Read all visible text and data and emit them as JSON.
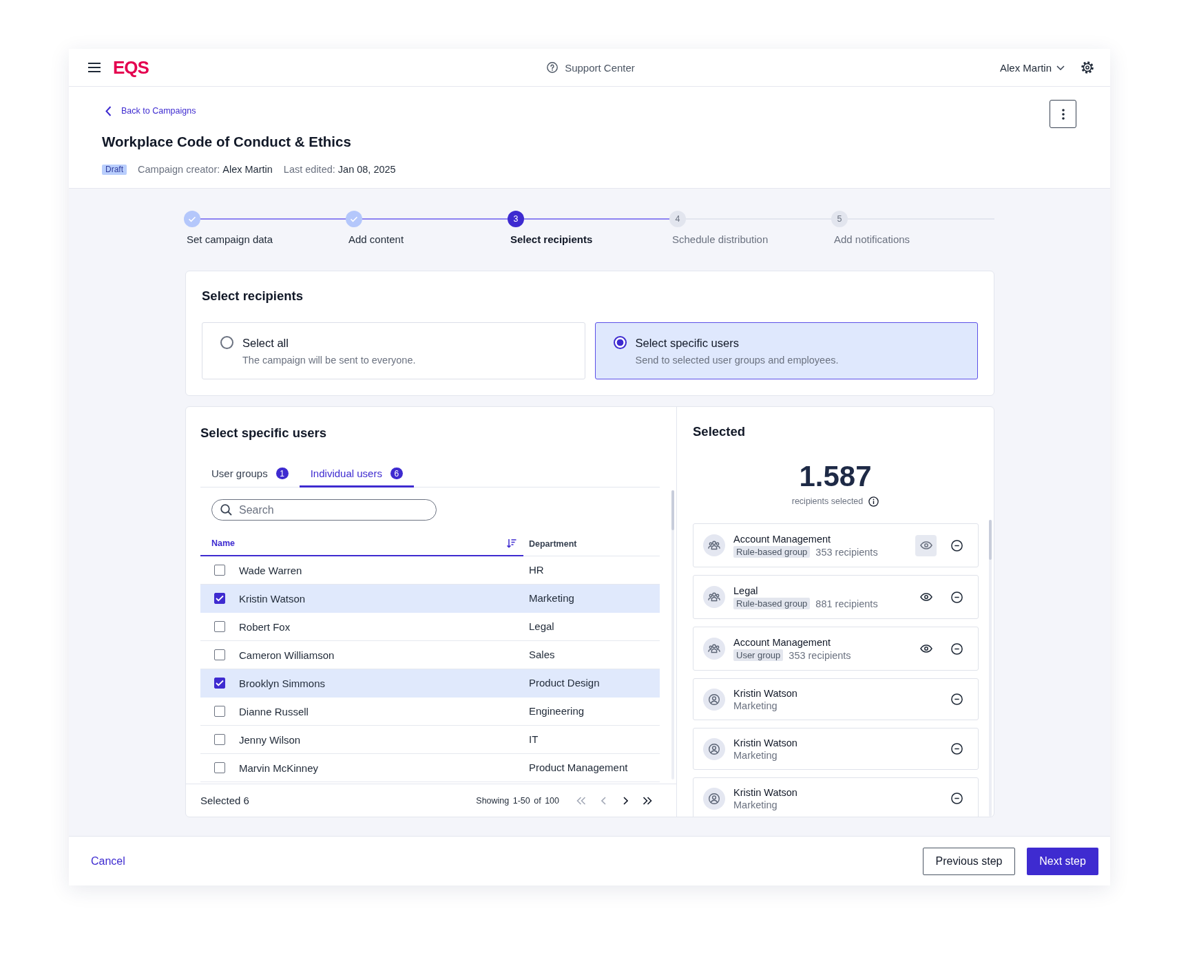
{
  "header": {
    "logo": "EQS",
    "support": "Support Center",
    "user": "Alex Martin"
  },
  "campaign": {
    "back": "Back to Campaigns",
    "title": "Workplace Code of Conduct & Ethics",
    "status": "Draft",
    "creator_label": "Campaign creator:",
    "creator": "Alex Martin",
    "edited_label": "Last edited:",
    "edited": "Jan 08, 2025"
  },
  "steps": [
    {
      "label": "Set campaign data",
      "completed": true,
      "active": false
    },
    {
      "label": "Add content",
      "completed": true,
      "active": false
    },
    {
      "label": "Select recipients",
      "number": "3",
      "completed": false,
      "active": true
    },
    {
      "label": "Schedule distribution",
      "number": "4",
      "completed": false,
      "active": false
    },
    {
      "label": "Add notifications",
      "number": "5",
      "completed": false,
      "active": false
    }
  ],
  "recipients": {
    "title": "Select recipients",
    "options": [
      {
        "title": "Select all",
        "description": "The campaign will be sent to everyone.",
        "selected": false
      },
      {
        "title": "Select specific users",
        "description": "Send to selected user groups and employees.",
        "selected": true
      }
    ]
  },
  "users": {
    "title": "Select specific users",
    "tabs": [
      {
        "label": "User groups",
        "count": "1",
        "selected": false
      },
      {
        "label": "Individual users",
        "count": "6",
        "selected": true
      }
    ],
    "search": {
      "placeholder": "Search"
    },
    "columns": [
      {
        "label": "Name",
        "sorted": true
      },
      {
        "label": "Department",
        "sorted": false
      }
    ],
    "rows": [
      {
        "name": "Wade Warren",
        "department": "HR",
        "checked": false
      },
      {
        "name": "Kristin Watson",
        "department": "Marketing",
        "checked": true
      },
      {
        "name": "Robert Fox",
        "department": "Legal",
        "checked": false
      },
      {
        "name": "Cameron Williamson",
        "department": "Sales",
        "checked": false
      },
      {
        "name": "Brooklyn Simmons",
        "department": "Product Design",
        "checked": true
      },
      {
        "name": "Dianne Russell",
        "department": "Engineering",
        "checked": false
      },
      {
        "name": "Jenny Wilson",
        "department": "IT",
        "checked": false
      },
      {
        "name": "Marvin McKinney",
        "department": "Product Management",
        "checked": false
      }
    ],
    "selected_count": "Selected 6",
    "showing": "Showing 1-50 of 100",
    "pagination": [
      {
        "kind": "first",
        "disabled": true
      },
      {
        "kind": "previous",
        "disabled": true
      },
      {
        "kind": "next",
        "disabled": false
      },
      {
        "kind": "last",
        "disabled": false
      }
    ]
  },
  "selected": {
    "title": "Selected",
    "total": "1.587",
    "caption": "recipients selected",
    "items": [
      {
        "kind": "group",
        "name": "Account Management",
        "tag": "Rule-based group",
        "count": "353 recipients",
        "preview_hovered": true
      },
      {
        "kind": "group",
        "name": "Legal",
        "tag": "Rule-based group",
        "count": "881 recipients",
        "preview_hovered": false
      },
      {
        "kind": "group",
        "name": "Account Management",
        "tag": "User group",
        "count": "353 recipients",
        "preview_hovered": false
      },
      {
        "kind": "user",
        "name": "Kristin Watson",
        "department": "Marketing"
      },
      {
        "kind": "user",
        "name": "Kristin Watson",
        "department": "Marketing"
      },
      {
        "kind": "user",
        "name": "Kristin Watson",
        "department": "Marketing"
      }
    ]
  },
  "footer": {
    "cancel": "Cancel",
    "previous": "Previous step",
    "next": "Next step"
  }
}
